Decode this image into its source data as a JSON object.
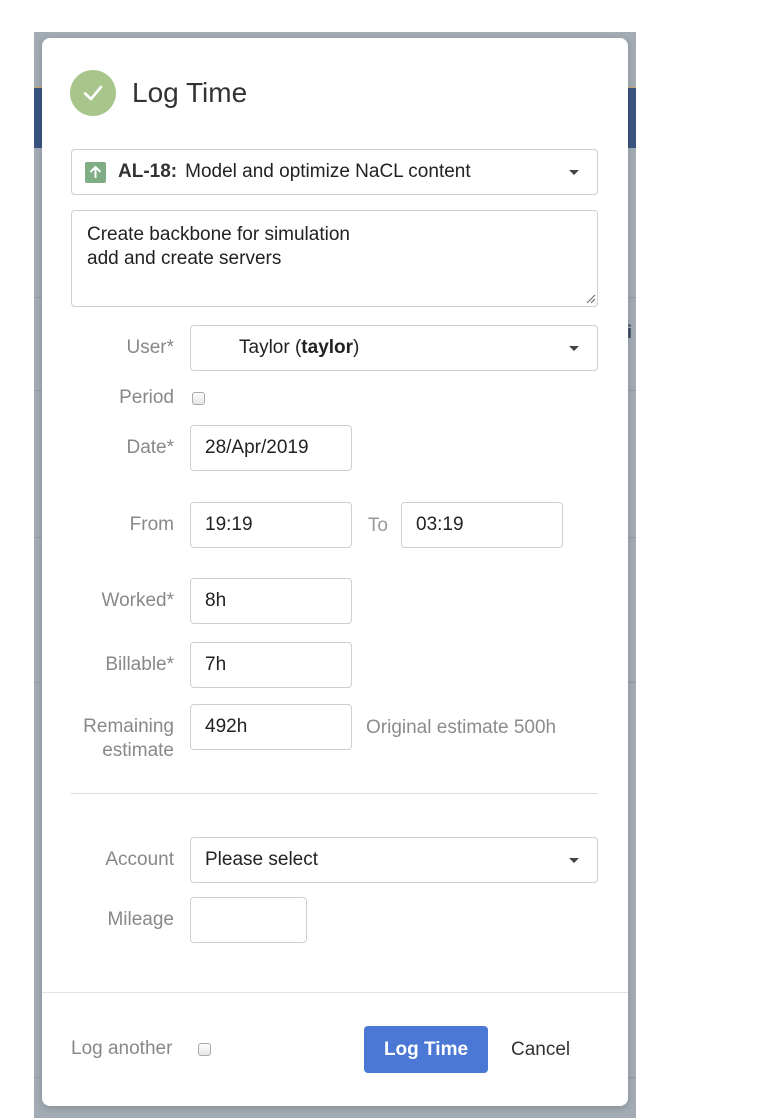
{
  "dialog": {
    "title": "Log Time",
    "header_icon": "check-circle-icon",
    "accent_color": "#a8c58c"
  },
  "issue": {
    "type_icon": "arrow-up-icon",
    "key": "AL-18:",
    "summary": "Model and optimize NaCL content"
  },
  "description": {
    "value": "Create backbone for simulation\nadd and create servers"
  },
  "form": {
    "user": {
      "label": "User*",
      "display_name": "Taylor (",
      "username": "taylor",
      "suffix": ")"
    },
    "period": {
      "label": "Period",
      "checked": false
    },
    "date": {
      "label": "Date*",
      "value": "28/Apr/2019"
    },
    "from": {
      "label": "From",
      "value": "19:19"
    },
    "to": {
      "label": "To",
      "value": "03:19"
    },
    "worked": {
      "label": "Worked*",
      "value": "8h"
    },
    "billable": {
      "label": "Billable*",
      "value": "7h"
    },
    "remaining": {
      "label_line1": "Remaining",
      "label_line2": "estimate",
      "value": "492h",
      "hint": "Original estimate 500h"
    },
    "account": {
      "label": "Account",
      "value": "Please select"
    },
    "mileage": {
      "label": "Mileage",
      "value": ""
    }
  },
  "footer": {
    "log_another_label": "Log another",
    "log_another_checked": false,
    "primary_label": "Log Time",
    "primary_color": "#4a78d4",
    "cancel_label": "Cancel"
  }
}
